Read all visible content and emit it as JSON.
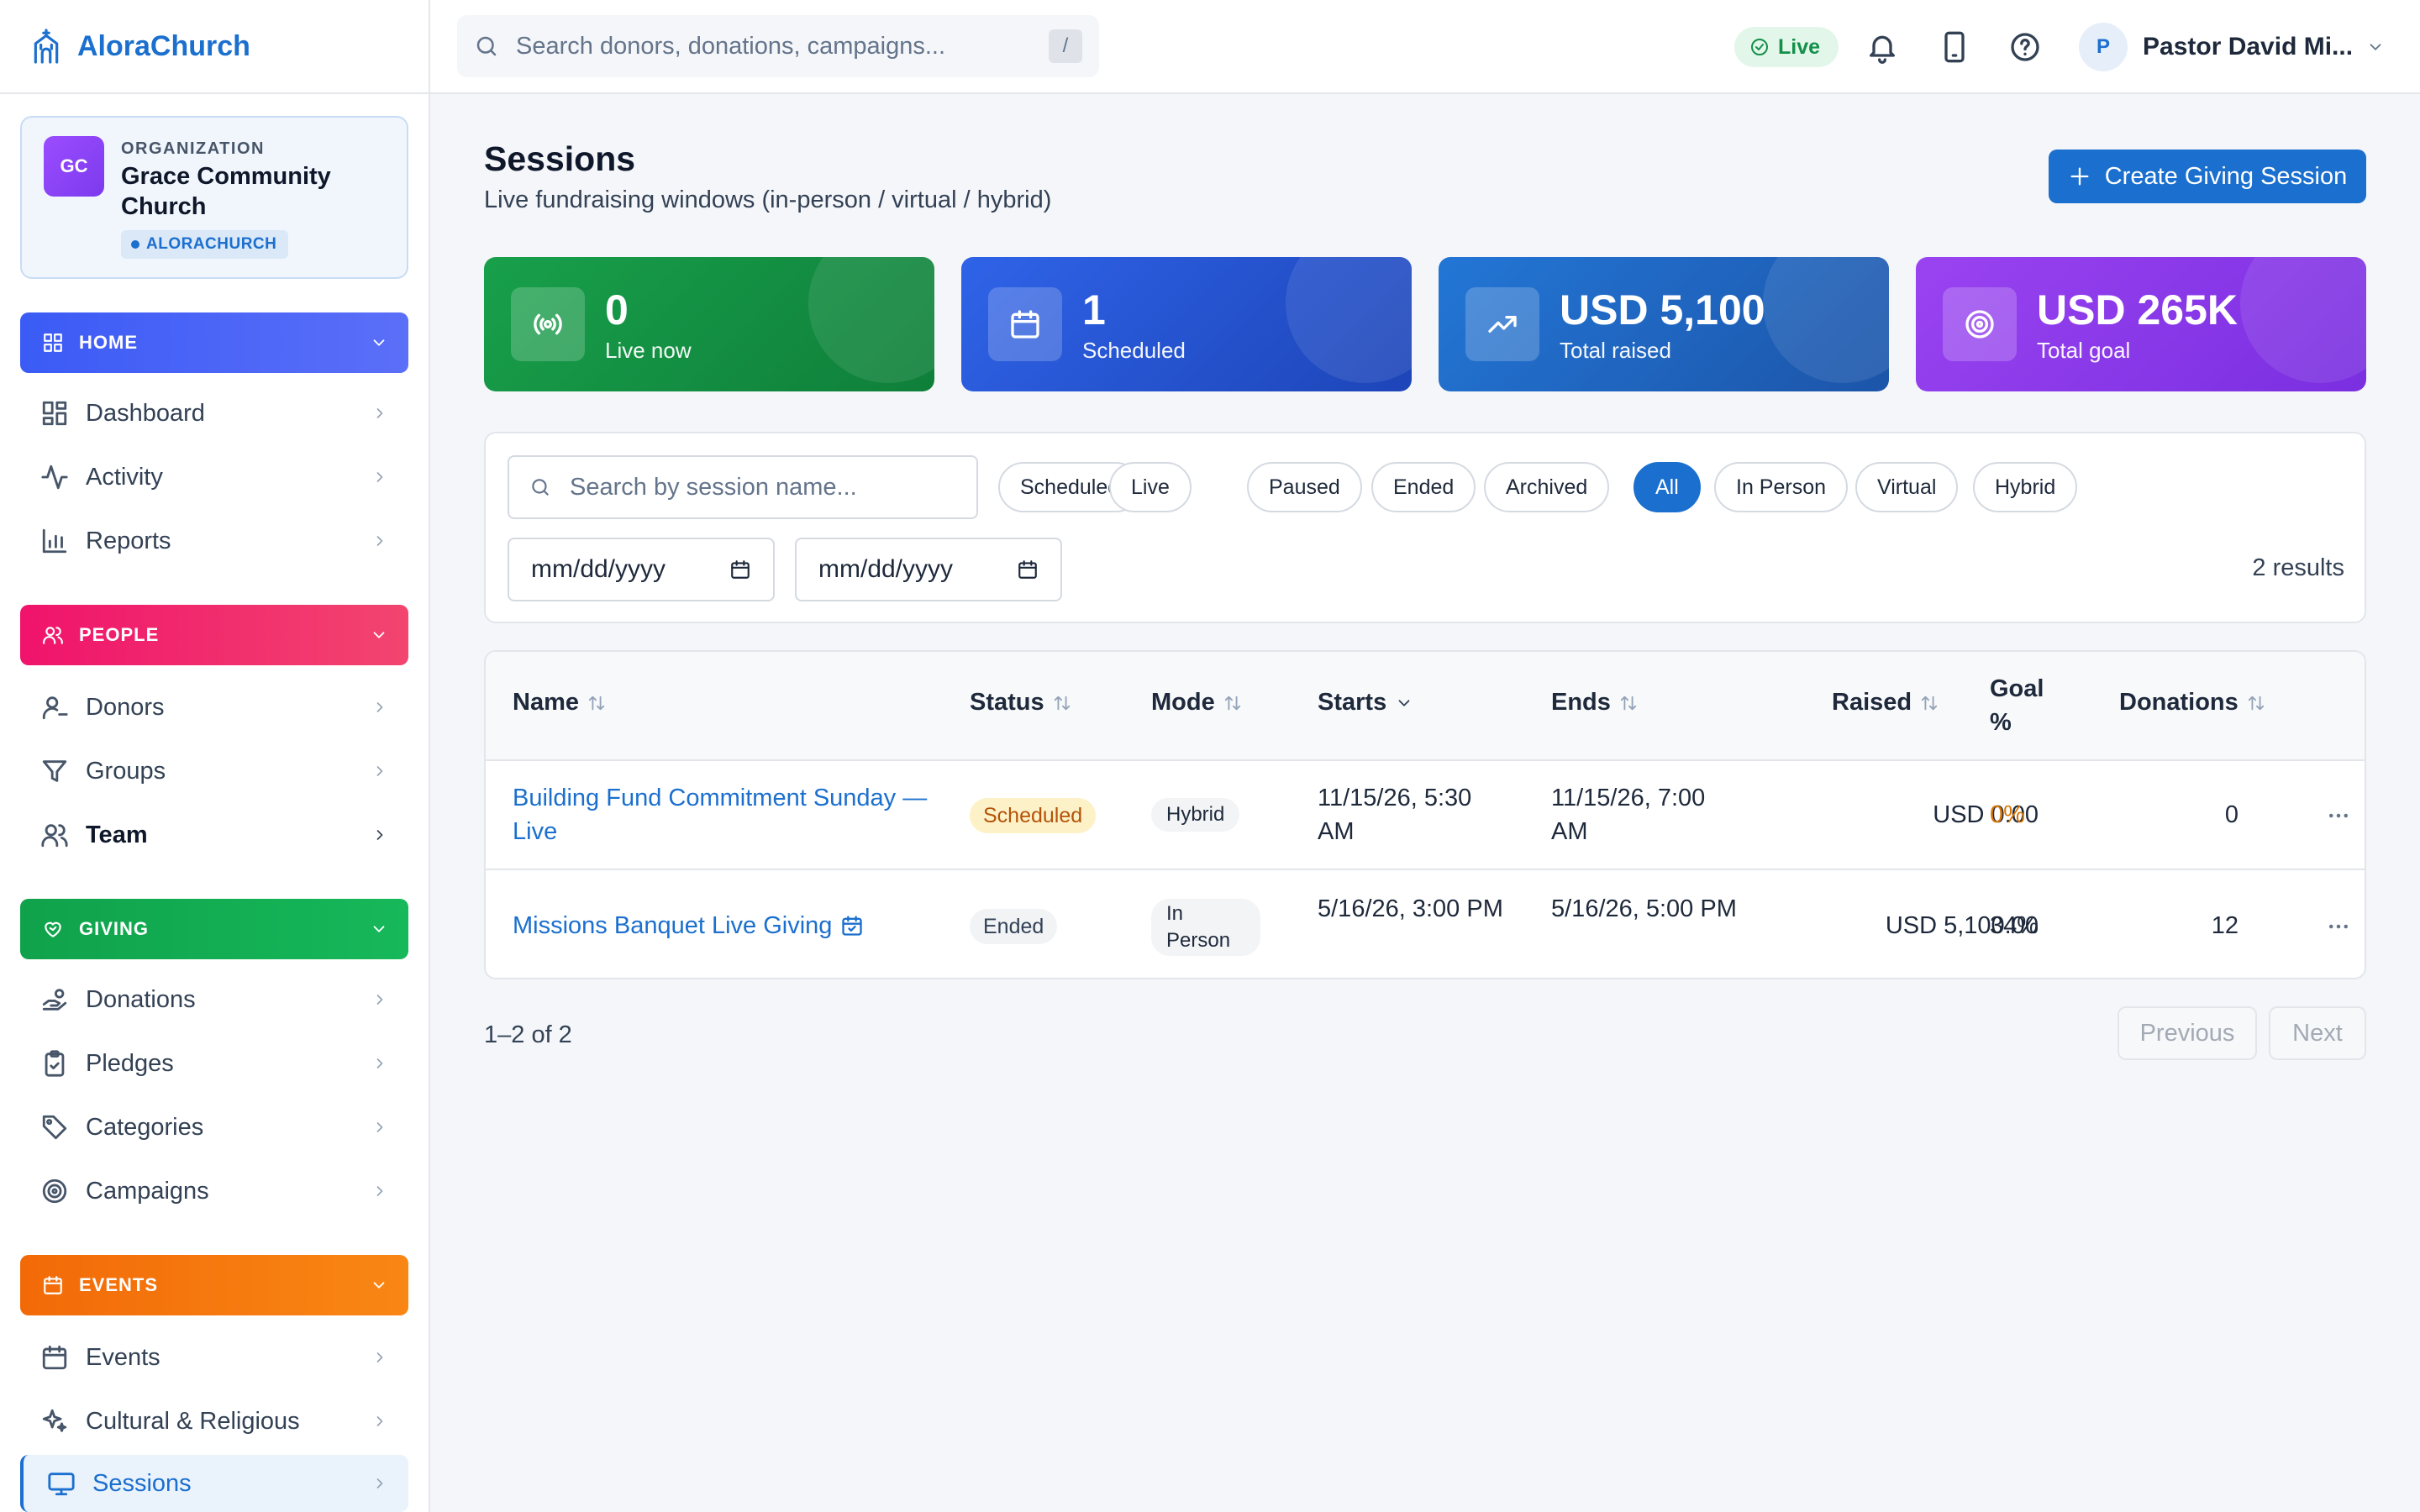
{
  "app": {
    "name": "AloraChurch"
  },
  "org": {
    "kicker": "ORGANIZATION",
    "initials": "GC",
    "name": "Grace Community Church",
    "tag": "ALORACHURCH"
  },
  "sidebar": {
    "sections": [
      {
        "title": "HOME",
        "color": "#3b5bf6",
        "items": [
          {
            "label": "Dashboard"
          },
          {
            "label": "Activity"
          },
          {
            "label": "Reports"
          }
        ]
      },
      {
        "title": "PEOPLE",
        "color": "#f0136c",
        "items": [
          {
            "label": "Donors"
          },
          {
            "label": "Groups"
          },
          {
            "label": "Team"
          }
        ]
      },
      {
        "title": "GIVING",
        "color": "#10a24b",
        "items": [
          {
            "label": "Donations"
          },
          {
            "label": "Pledges"
          },
          {
            "label": "Categories"
          },
          {
            "label": "Campaigns"
          }
        ]
      },
      {
        "title": "EVENTS",
        "color": "#f26a08",
        "items": [
          {
            "label": "Events"
          },
          {
            "label": "Cultural & Religious"
          },
          {
            "label": "Sessions"
          }
        ]
      }
    ]
  },
  "topbar": {
    "search_placeholder": "Search donors, donations, campaigns...",
    "shortcut": "/",
    "live_label": "Live",
    "user_initial": "P",
    "user_name": "Pastor David Mi..."
  },
  "page": {
    "title": "Sessions",
    "subtitle": "Live fundraising windows (in-person / virtual / hybrid)",
    "create_button": "Create Giving Session"
  },
  "stats": [
    {
      "value": "0",
      "label": "Live now",
      "color": "#18a04b"
    },
    {
      "value": "1",
      "label": "Scheduled",
      "color": "#2f63e8"
    },
    {
      "value": "USD 5,100",
      "label": "Total raised",
      "color": "#2376d6"
    },
    {
      "value": "USD 265K",
      "label": "Total goal",
      "color": "#9a43f1"
    }
  ],
  "filters": {
    "search_placeholder": "Search by session name...",
    "chips": [
      "Scheduled",
      "Live",
      "Paused",
      "Ended",
      "Archived",
      "All",
      "In Person",
      "Virtual",
      "Hybrid"
    ],
    "selected_chip": "All",
    "date_from_placeholder": "mm/dd/yyyy",
    "date_to_placeholder": "mm/dd/yyyy",
    "results": "2 results"
  },
  "table": {
    "columns": [
      "Name",
      "Status",
      "Mode",
      "Starts",
      "Ends",
      "Raised",
      "Goal %",
      "Donations"
    ],
    "rows": [
      {
        "name": "Building Fund Commitment Sunday — Live",
        "status": "Scheduled",
        "mode": "Hybrid",
        "starts": "11/15/26, 5:30 AM",
        "ends": "11/15/26, 7:00 AM",
        "raised": "USD 0.00",
        "goal_pct": "0%",
        "donations": "0"
      },
      {
        "name": "Missions Banquet Live Giving",
        "status": "Ended",
        "mode": "In Person",
        "starts": "5/16/26, 3:00 PM",
        "ends": "5/16/26, 5:00 PM",
        "raised": "USD 5,100.00",
        "goal_pct": "34%",
        "donations": "12"
      }
    ]
  },
  "pagination": {
    "info": "1–2 of 2",
    "previous": "Previous",
    "next": "Next"
  },
  "colors": {
    "accent": "#1b6fce",
    "warning_text": "#d97706"
  }
}
